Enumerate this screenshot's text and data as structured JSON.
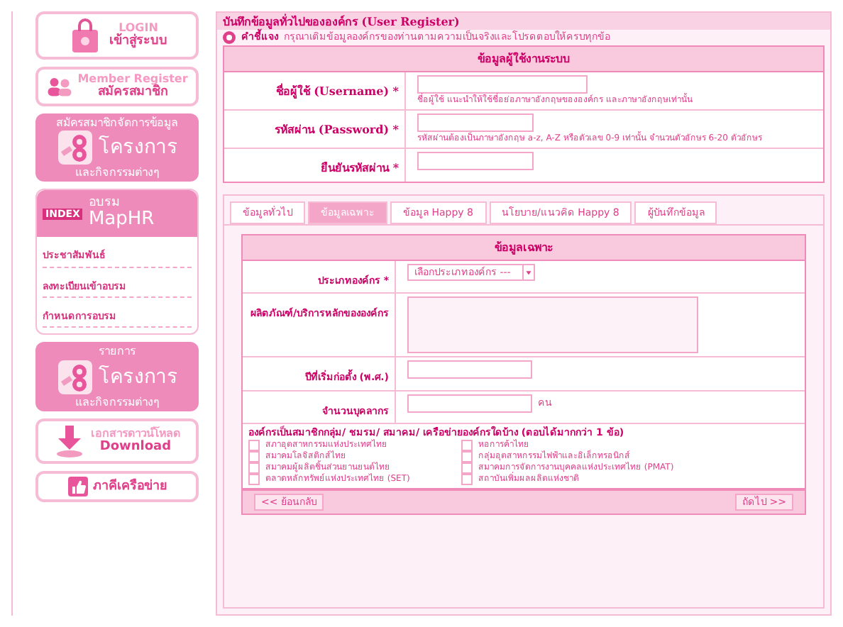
{
  "sidebar": {
    "items": [
      {
        "kind": "button",
        "lines": [
          "LOGIN",
          "เข้าสู่ระบบ"
        ]
      },
      {
        "kind": "button",
        "lines": [
          "Member Register",
          "สมัครสมาชิก"
        ]
      },
      {
        "kind": "banner",
        "lines": [
          "สมัครสมาชิกจัดการข้อมูล",
          "โครงการ",
          "และกิจกรรมต่างๆ"
        ]
      },
      {
        "kind": "training",
        "badge": "INDEX",
        "lines": [
          "อบรม",
          "MapHR"
        ],
        "links": [
          "ประชาสัมพันธ์",
          "ลงทะเบียนเข้าอบรม",
          "กำหนดการอบรม"
        ]
      },
      {
        "kind": "banner",
        "lines": [
          "รายการ",
          "โครงการ",
          "และกิจกรรมต่างๆ"
        ]
      },
      {
        "kind": "button",
        "lines": [
          "เอกสารดาวน์โหลด",
          "Download"
        ]
      },
      {
        "kind": "button",
        "lines": [
          "ภาคีเครือข่าย"
        ]
      }
    ]
  },
  "panel": {
    "title": "บันทึกข้อมูลทั่วไปขององค์กร (User Register)",
    "note_label": "คำชี้แจง",
    "note": "กรุณาเติมข้อมูลองค์กรของท่านตามความเป็นจริงและโปรดตอบให้ครบทุกข้อ"
  },
  "user_section": {
    "title": "ข้อมูลผู้ใช้งานระบบ",
    "rows": [
      {
        "label": "ชื่อผู้ใช้ (Username) *",
        "hint": "ชื่อผู้ใช้ แนะนำให้ใช้ชื่อย่อภาษาอังกฤษขององค์กร และภาษาอังกฤษเท่านั้น"
      },
      {
        "label": "รหัสผ่าน (Password) *",
        "hint": "รหัสผ่านต้องเป็นภาษาอังกฤษ a-z, A-Z หรือตัวเลข 0-9 เท่านั้น จำนวนตัวอักษร 6-20 ตัวอักษร"
      },
      {
        "label": "ยืนยันรหัสผ่าน *"
      }
    ]
  },
  "tabs": [
    {
      "label": "ข้อมูลทั่วไป",
      "selected": false
    },
    {
      "label": "ข้อมูลเฉพาะ",
      "selected": true
    },
    {
      "label": "ข้อมูล Happy 8",
      "selected": false
    },
    {
      "label": "นโยบาย/แนวคิด Happy 8",
      "selected": false
    },
    {
      "label": "ผู้บันทึกข้อมูล",
      "selected": false
    }
  ],
  "specific_section": {
    "title": "ข้อมูลเฉพาะ",
    "rows": [
      {
        "kind": "select",
        "label": "ประเภทองค์กร *",
        "value": "เลือกประเภทองค์กร ---"
      },
      {
        "kind": "textarea",
        "label": "ผลิตภัณฑ์/บริการหลักขององค์กร"
      },
      {
        "kind": "input",
        "label": "ปีที่เริ่มก่อตั้ง (พ.ศ.)"
      },
      {
        "kind": "input",
        "label": "จำนวนบุคลากร",
        "unit": "คน"
      }
    ],
    "question": "องค์กรเป็นสมาชิกกลุ่ม/ ชมรม/ สมาคม/ เครือข่ายองค์กรใดบ้าง (ตอบได้มากกว่า 1 ข้อ)",
    "options": [
      {
        "label": "สภาอุตสาหกรรมแห่งประเทศไทย",
        "checked": false
      },
      {
        "label": "หอการค้าไทย",
        "checked": false
      },
      {
        "label": "สมาคมโลจิสติกส์ไทย",
        "checked": false
      },
      {
        "label": "กลุ่มอุตสาหกรรมไฟฟ้าและอิเล็กทรอนิกส์",
        "checked": false
      },
      {
        "label": "สมาคมผู้ผลิตชิ้นส่วนยานยนต์ไทย",
        "checked": false
      },
      {
        "label": "สมาคมการจัดการงานบุคคลแห่งประเทศไทย (PMAT)",
        "checked": false
      },
      {
        "label": "ตลาดหลักทรัพย์แห่งประเทศไทย (SET)",
        "checked": false
      },
      {
        "label": "สถาบันเพิ่มผลผลิตแห่งชาติ",
        "checked": false
      }
    ],
    "back_button": "<< ย้อนกลับ",
    "next_button": "ถัดไป >>"
  }
}
